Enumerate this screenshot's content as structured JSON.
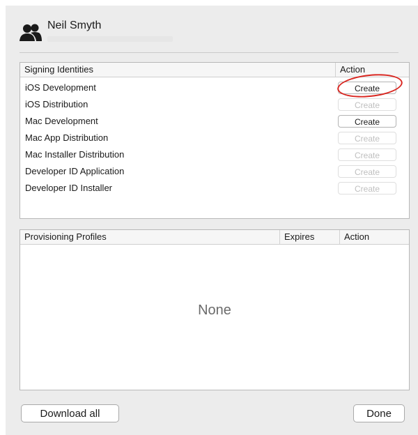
{
  "header": {
    "user_name": "Neil Smyth",
    "avatar_icon": "users-icon"
  },
  "identities": {
    "columns": [
      "Signing Identities",
      "Action"
    ],
    "rows": [
      {
        "label": "iOS Development",
        "action": "Create",
        "enabled": true
      },
      {
        "label": "iOS Distribution",
        "action": "Create",
        "enabled": false
      },
      {
        "label": "Mac Development",
        "action": "Create",
        "enabled": true
      },
      {
        "label": "Mac App Distribution",
        "action": "Create",
        "enabled": false
      },
      {
        "label": "Mac Installer Distribution",
        "action": "Create",
        "enabled": false
      },
      {
        "label": "Developer ID Application",
        "action": "Create",
        "enabled": false
      },
      {
        "label": "Developer ID Installer",
        "action": "Create",
        "enabled": false
      }
    ]
  },
  "profiles": {
    "columns": [
      "Provisioning Profiles",
      "Expires",
      "Action"
    ],
    "empty_text": "None"
  },
  "footer": {
    "download_label": "Download all",
    "done_label": "Done"
  },
  "colors": {
    "highlight": "#d9251f",
    "background": "#ececec"
  }
}
